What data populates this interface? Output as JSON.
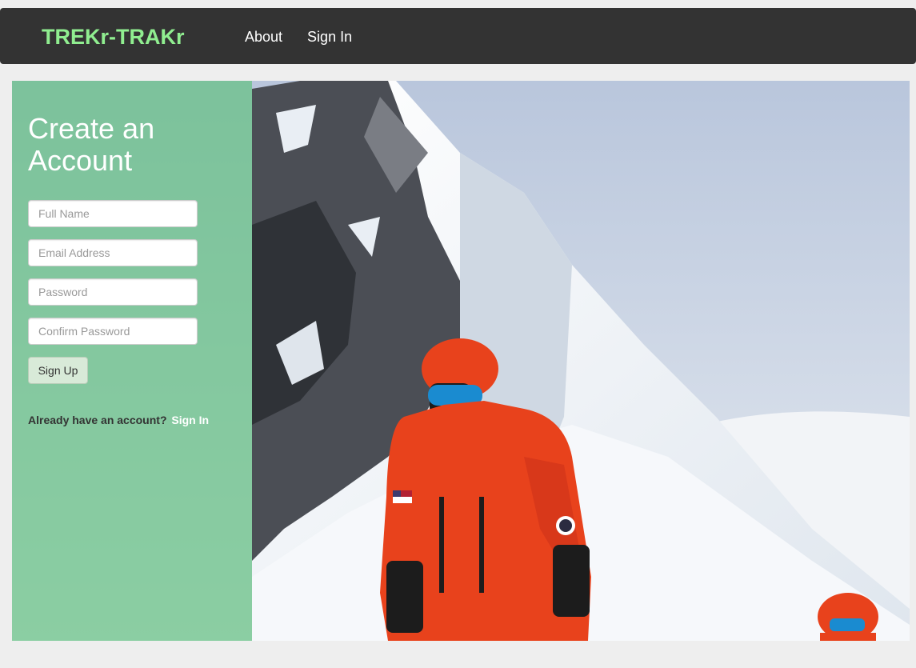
{
  "navbar": {
    "brand": "TREKr-TRAKr",
    "links": [
      "About",
      "Sign In"
    ],
    "brand_color": "#90ee90",
    "background": "#333333"
  },
  "hero": {
    "image": "mountaineer-on-snowy-ridge",
    "panel_color": "#60bf7d"
  },
  "signup_form": {
    "title": "Create an Account",
    "fields": {
      "full_name": {
        "placeholder": "Full Name"
      },
      "email": {
        "placeholder": "Email Address"
      },
      "password": {
        "placeholder": "Password"
      },
      "confirm_password": {
        "placeholder": "Confirm Password"
      }
    },
    "submit_label": "Sign Up",
    "have_account_text": "Already have an account?",
    "sign_in_link": "Sign In"
  }
}
